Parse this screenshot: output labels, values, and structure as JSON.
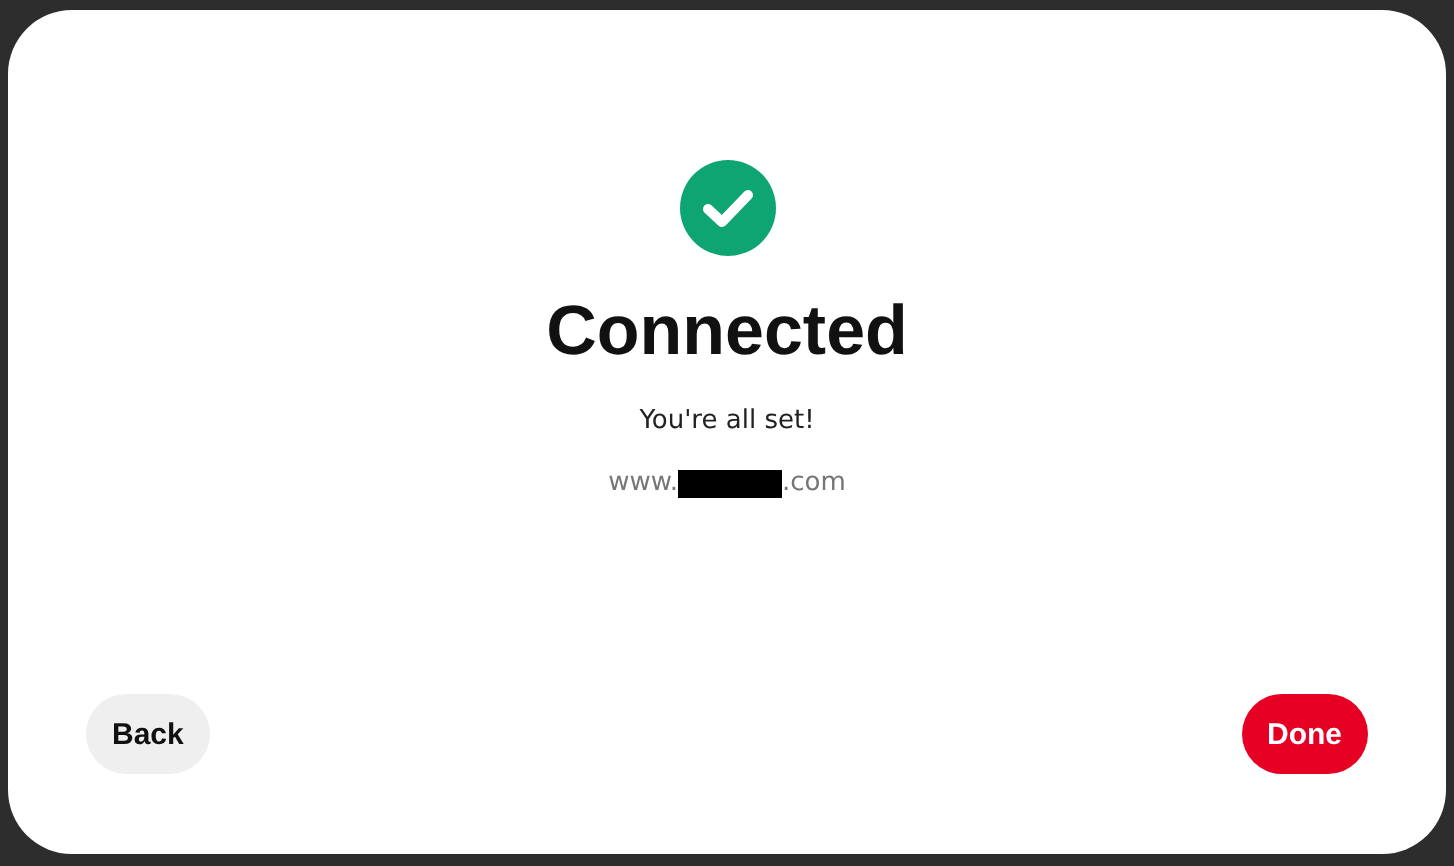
{
  "dialog": {
    "title": "Connected",
    "message": "You're all set!",
    "url_prefix": "www.",
    "url_suffix": ".com",
    "url_redacted": true
  },
  "buttons": [
    {
      "label": "Back",
      "kind": "secondary"
    },
    {
      "label": "Done",
      "kind": "primary"
    }
  ]
}
